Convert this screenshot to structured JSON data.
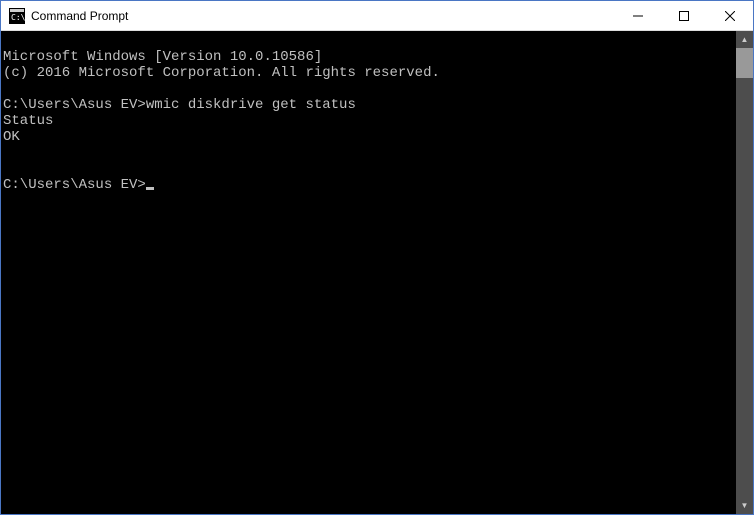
{
  "window": {
    "title": "Command Prompt"
  },
  "terminal": {
    "lines": [
      "Microsoft Windows [Version 10.0.10586]",
      "(c) 2016 Microsoft Corporation. All rights reserved.",
      "",
      "C:\\Users\\Asus EV>wmic diskdrive get status",
      "Status",
      "OK",
      "",
      "",
      "C:\\Users\\Asus EV>"
    ],
    "prompt": "C:\\Users\\Asus EV>",
    "command1": "wmic diskdrive get status",
    "header_line": "Microsoft Windows [Version 10.0.10586]",
    "copyright_line": "(c) 2016 Microsoft Corporation. All rights reserved.",
    "output_header": "Status",
    "output_value": "OK"
  }
}
